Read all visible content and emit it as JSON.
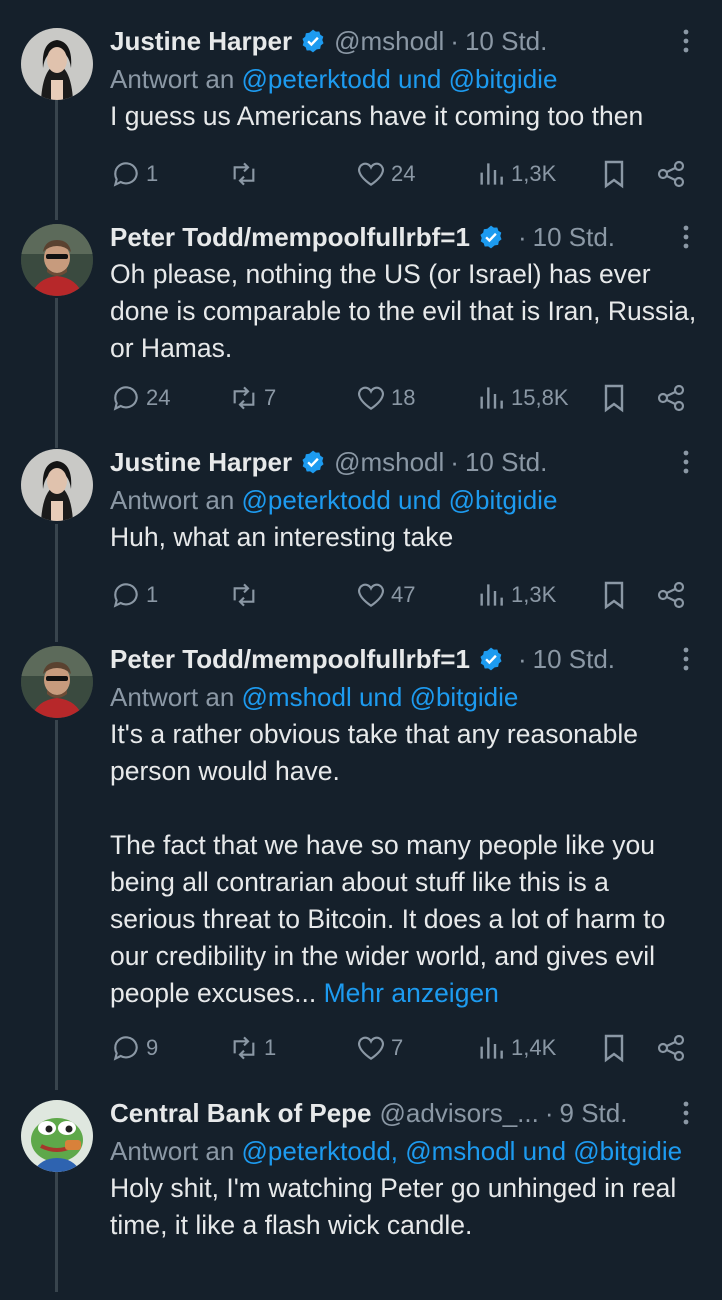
{
  "tweets": [
    {
      "name": "Justine Harper",
      "handle": "@mshodl",
      "dot": "·",
      "time": "10 Std.",
      "reply_prefix": "Antwort an",
      "reply_mentions": "@peterktodd und @bitgidie",
      "text": "I guess us Americans have it coming too then",
      "more_link": "",
      "replies": "1",
      "retweets": "",
      "likes": "24",
      "views": "1,3K"
    },
    {
      "name": "Peter Todd/mempoolfullrbf=1",
      "handle": "",
      "dot": "·",
      "time": "10 Std.",
      "reply_prefix": "",
      "reply_mentions": "",
      "text": "Oh please, nothing the US (or Israel) has ever done is comparable to the evil that is Iran, Russia, or Hamas.",
      "more_link": "",
      "replies": "24",
      "retweets": "7",
      "likes": "18",
      "views": "15,8K"
    },
    {
      "name": "Justine Harper",
      "handle": "@mshodl",
      "dot": "·",
      "time": "10 Std.",
      "reply_prefix": "Antwort an",
      "reply_mentions": "@peterktodd und @bitgidie",
      "text": "Huh, what an interesting take",
      "more_link": "",
      "replies": "1",
      "retweets": "",
      "likes": "47",
      "views": "1,3K"
    },
    {
      "name": "Peter Todd/mempoolfullrbf=1",
      "handle": "",
      "dot": "·",
      "time": "10 Std.",
      "reply_prefix": "Antwort an",
      "reply_mentions": "@mshodl und @bitgidie",
      "text": "It's a rather obvious take that any reasonable person would have.\n\nThe fact that we have so many people like you being all contrarian about stuff like this is a serious threat to Bitcoin. It does a lot of harm to our credibility in the wider world, and gives evil people excuses... ",
      "more_link": "Mehr anzeigen",
      "replies": "9",
      "retweets": "1",
      "likes": "7",
      "views": "1,4K"
    },
    {
      "name": "Central Bank of Pepe",
      "handle": "@advisors_...",
      "dot": "·",
      "time": "9 Std.",
      "reply_prefix": "Antwort an",
      "reply_mentions": "@peterktodd, @mshodl und @bitgidie",
      "text": "Holy shit, I'm watching Peter go unhinged in real time, it like a flash wick candle.",
      "more_link": "",
      "replies": "",
      "retweets": "",
      "likes": "",
      "views": ""
    }
  ],
  "colors": {
    "background": "#15202b",
    "text": "#e7e9ea",
    "muted": "#8b98a5",
    "accent": "#1d9bf0",
    "thread_line": "#38444d"
  },
  "icons": [
    "verified-badge-icon",
    "more-icon",
    "reply-icon",
    "retweet-icon",
    "like-icon",
    "views-icon",
    "bookmark-icon",
    "share-icon"
  ]
}
